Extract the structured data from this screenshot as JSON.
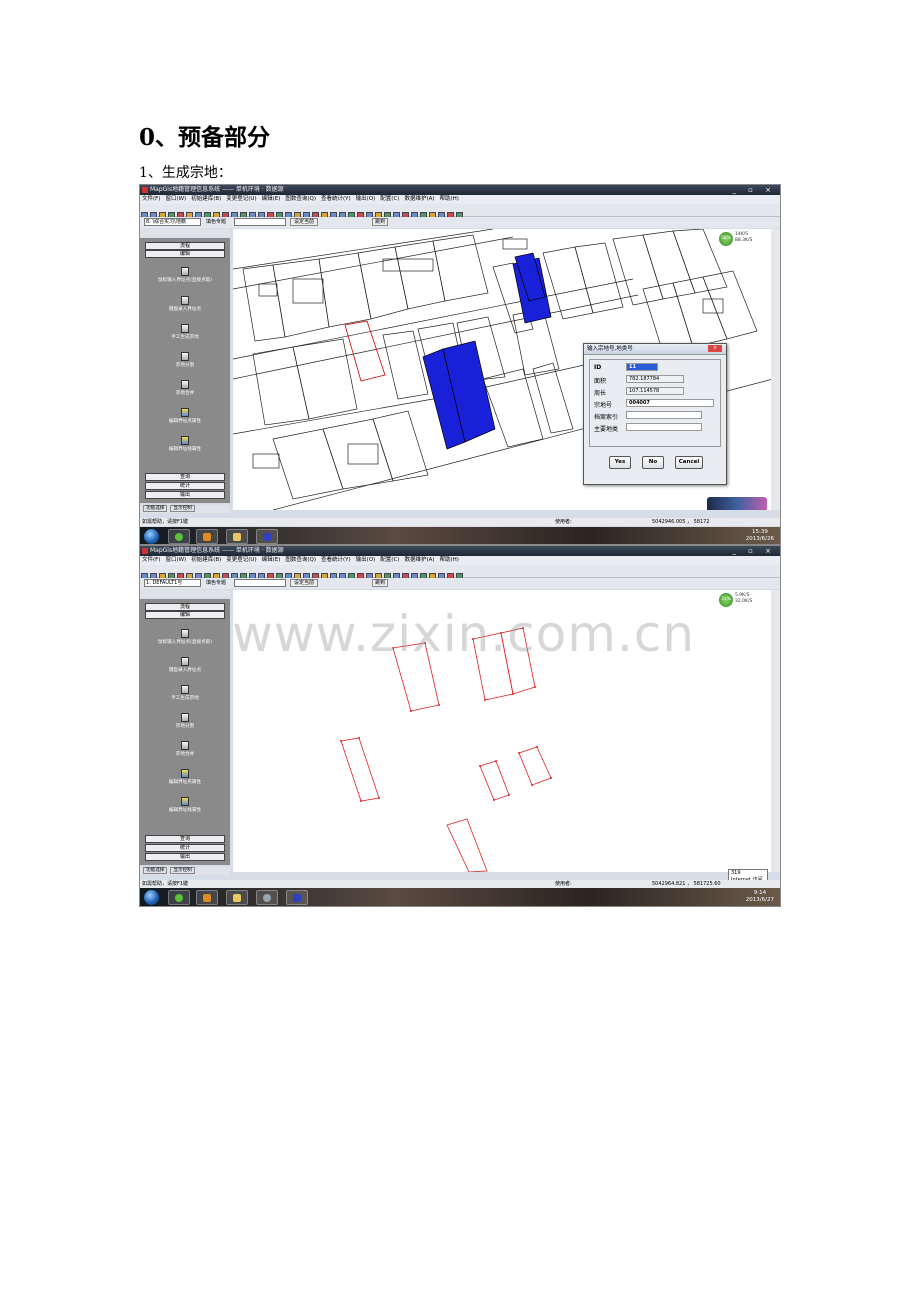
{
  "doc": {
    "heading": "0、预备部分",
    "subheading": "1、生成宗地："
  },
  "app": {
    "title": "MapGis地籍管理信息系统 —— 单机环境 · 数据源",
    "menus": [
      "文件(F)",
      "窗口(W)",
      "初始建库(B)",
      "变更登记(U)",
      "编辑(E)",
      "图数查询(Q)",
      "查看统计(Y)",
      "输出(O)",
      "配置(C)",
      "数据维护(A)",
      "帮助(H)"
    ],
    "layer_select_1": "8: \\综合实习\\地籍",
    "layer_select_2": "1: DEFAULT1号",
    "theme_label": "填色专题",
    "set_current": "设定当前",
    "pick_button": "跳到",
    "panel": {
      "process": "流程",
      "edit": "编辑",
      "items": [
        "鼠标输入界址点(直接点取)",
        "键盘录入界址点",
        "手工生成宗地",
        "宗地分割",
        "宗地合并",
        "编辑界址点属性",
        "编辑界址线属性"
      ],
      "query": "查询",
      "stats": "统计",
      "output": "输出",
      "tab_func": "功能选择",
      "tab_display": "显示控制"
    },
    "status_help": "如需帮助，请按F1键",
    "status_user": "使用者:",
    "status_coords_1": "5042946.005 ， 58172",
    "status_coords_2": "5042964.821 ， 581725.60",
    "clock_1": {
      "time": "15:39",
      "date": "2013/6/26"
    },
    "clock_2": {
      "time": "9:14",
      "date": "2013/6/27"
    },
    "badge_1": {
      "pct": "58%",
      "up": "14K/S",
      "down": "88.3K/S"
    },
    "badge_2": {
      "pct": "31%",
      "up": "5.9K/S",
      "down": "32.0K/S"
    },
    "ie_tip": "319",
    "ie_tip2": "Internet 访问"
  },
  "dialog": {
    "title": "输入宗地号,地类号",
    "fields": [
      {
        "label": "ID",
        "value": "11"
      },
      {
        "label": "面积",
        "value": "782.187784"
      },
      {
        "label": "周长",
        "value": "107.114578"
      },
      {
        "label": "宗地号",
        "value": "004007"
      },
      {
        "label": "档案索引",
        "value": ""
      },
      {
        "label": "主要地类",
        "value": ""
      }
    ],
    "yes": "Yes",
    "no": "No",
    "cancel": "Cancel"
  },
  "watermark": "www.zixin.com.cn"
}
